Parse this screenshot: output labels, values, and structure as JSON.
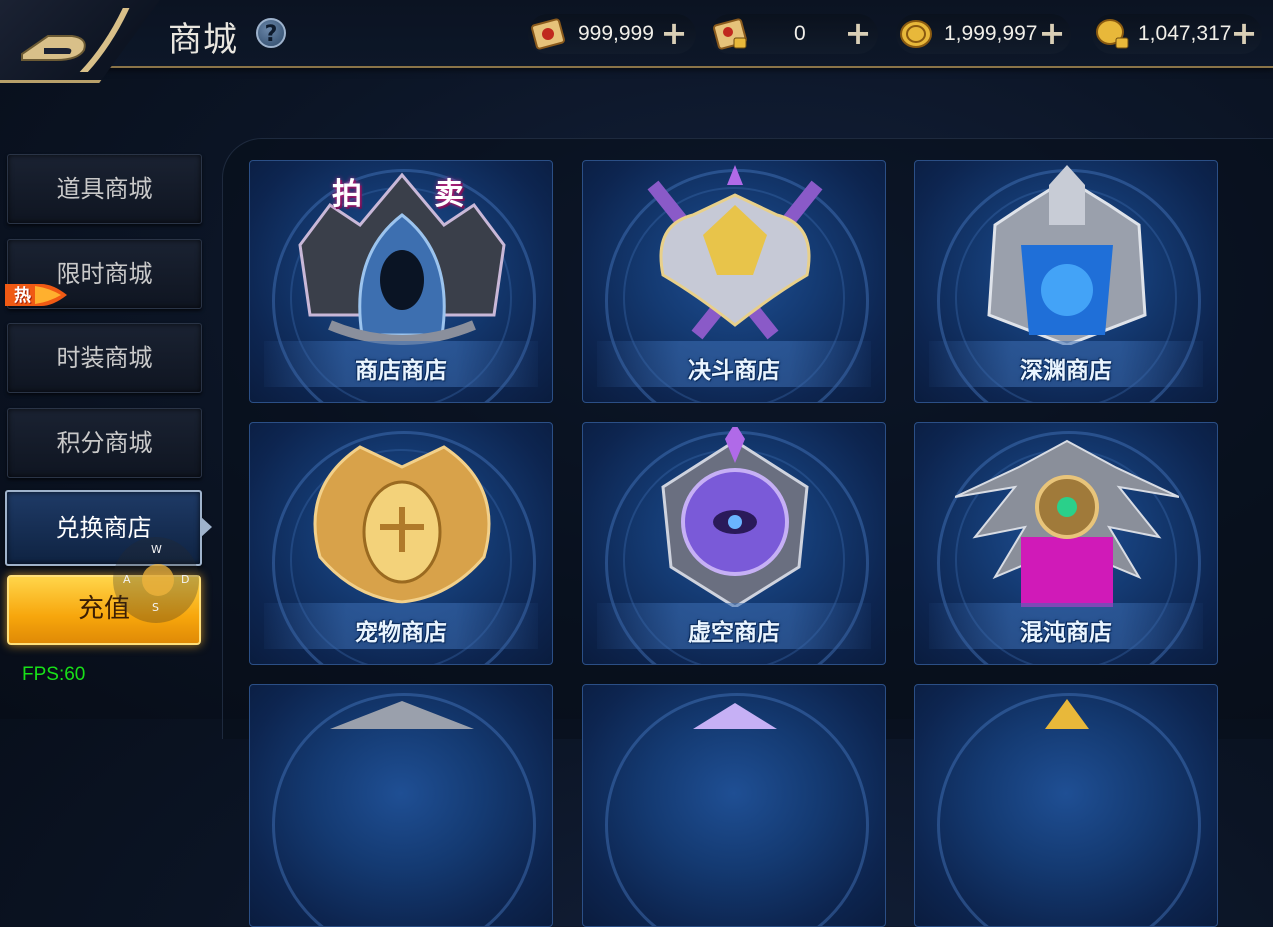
{
  "header": {
    "title": "商城",
    "help_glyph": "?",
    "currencies": [
      {
        "name": "scroll-icon",
        "value": "999,999"
      },
      {
        "name": "locked-scroll-icon",
        "value": "0"
      },
      {
        "name": "gold-coin-icon",
        "value": "1,999,997"
      },
      {
        "name": "locked-coin-icon",
        "value": "1,047,317"
      }
    ],
    "plus_glyph": "+"
  },
  "sidebar": {
    "items": [
      {
        "label": "道具商城"
      },
      {
        "label": "限时商城"
      },
      {
        "label": "时装商城"
      },
      {
        "label": "积分商城"
      },
      {
        "label": "兑换商店"
      }
    ],
    "hot_badge": "热",
    "recharge_label": "充值",
    "active_index": 4
  },
  "joystick": {
    "up": "W",
    "left": "A",
    "right": "D",
    "down": "S"
  },
  "fps": "FPS:60",
  "shops": [
    {
      "label": "商店商店",
      "tag_left": "拍",
      "tag_right": "卖",
      "emblem": "hooded-knight-icon"
    },
    {
      "label": "决斗商店",
      "emblem": "crossed-swords-icon"
    },
    {
      "label": "深渊商店",
      "emblem": "abyss-portal-icon"
    },
    {
      "label": "宠物商店",
      "emblem": "pet-egg-icon"
    },
    {
      "label": "虚空商店",
      "emblem": "void-eye-icon"
    },
    {
      "label": "混沌商店",
      "emblem": "chaos-orb-icon"
    }
  ],
  "colors": {
    "accent_gold": "#b8a06a",
    "card_blue": "#143a72",
    "recharge": "#f7a60c",
    "fps_green": "#18e018"
  }
}
